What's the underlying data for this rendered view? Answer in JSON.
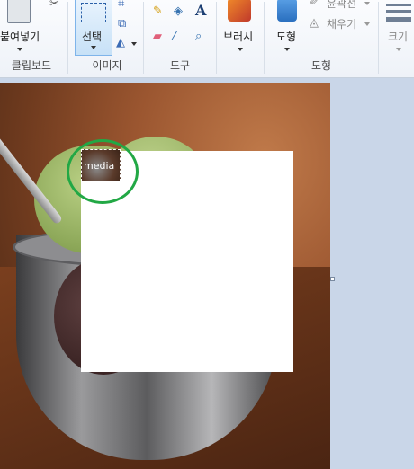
{
  "ribbon": {
    "clipboard": {
      "paste_label": "붙여넣기",
      "group_label": "클립보드"
    },
    "image": {
      "select_label": "선택",
      "group_label": "이미지"
    },
    "tools": {
      "group_label": "도구"
    },
    "brushes": {
      "label": "브러시"
    },
    "shapes": {
      "shapes_label": "도형",
      "outline_label": "윤곽선",
      "fill_label": "채우기",
      "group_label": "도형"
    },
    "size": {
      "label": "크기"
    }
  },
  "canvas": {
    "thumbnail_text": "media"
  },
  "colors": {
    "selection_highlight": "#c7e1f7",
    "annotation_circle": "#22a845"
  }
}
